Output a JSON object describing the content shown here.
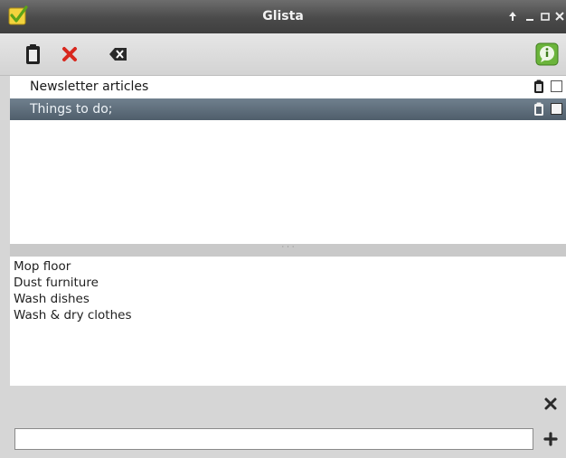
{
  "window": {
    "title": "Glista",
    "controls": [
      "arrow-up-icon",
      "minimize-icon",
      "maximize-icon",
      "close-icon"
    ]
  },
  "toolbar": {
    "buttons": [
      {
        "name": "paste-button",
        "icon": "clipboard-icon"
      },
      {
        "name": "delete-button",
        "icon": "red-x-icon",
        "color": "#d8281e"
      },
      {
        "name": "clear-button",
        "icon": "backspace-icon"
      },
      {
        "name": "about-button",
        "icon": "info-icon",
        "color": "#5aa532"
      }
    ]
  },
  "lists": {
    "items": [
      {
        "label": "Newsletter articles",
        "selected": false,
        "checked": false
      },
      {
        "label": "Things to do;",
        "selected": true,
        "checked": false
      }
    ],
    "selected_color": "#5b6a77"
  },
  "items": {
    "lines": [
      "Mop floor",
      "Dust furniture",
      "Wash dishes",
      "Wash & dry clothes"
    ]
  },
  "bottom": {
    "new_item_value": "",
    "new_item_placeholder": ""
  },
  "accent_colors": {
    "checkmark_green": "#7bbf2a",
    "delete_red": "#d8281e"
  }
}
